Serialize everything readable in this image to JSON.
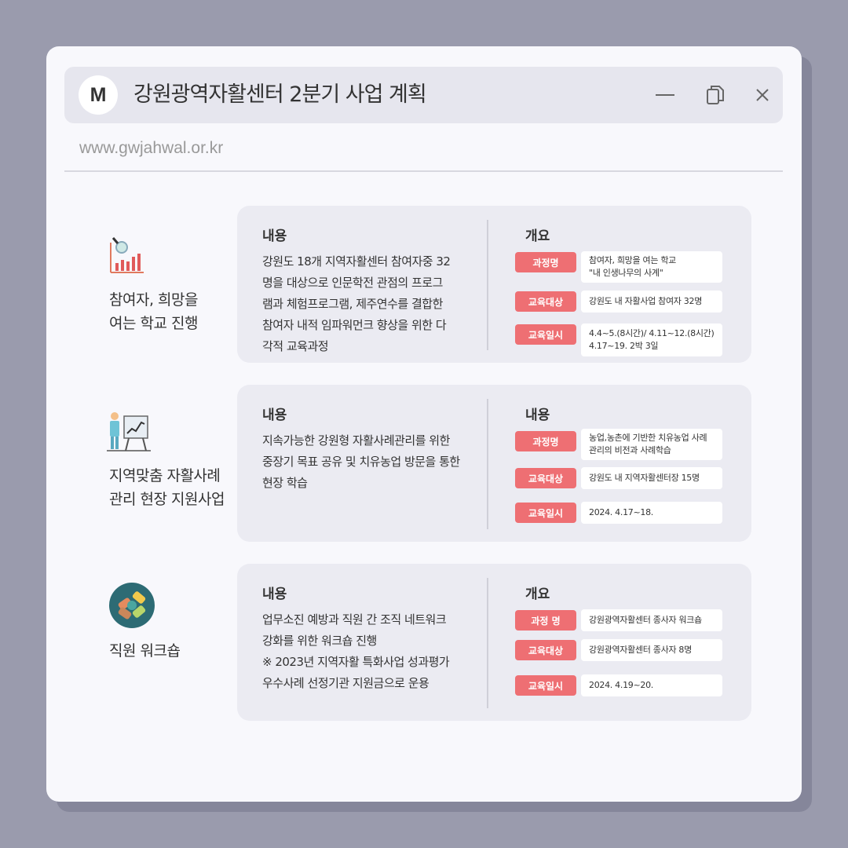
{
  "window": {
    "logo_letter": "M",
    "title": "강원광역자활센터 2분기 사업 계획",
    "url": "www.gwjahwal.or.kr"
  },
  "items": [
    {
      "label_line1": "참여자, 희망을",
      "label_line2": "여는 학교 진행",
      "icon": "chart-magnifier-icon",
      "heading_left": "내용",
      "heading_right": "개요",
      "body_line1": "강원도 18개 지역자활센터 참여자중 32",
      "body_line2": "명을 대상으로 인문학전 관점의 프로그",
      "body_line3": "램과 체험프로그램, 제주연수를 결합한",
      "body_line4": "참여자 내적 임파워먼크 향상을 위한 다",
      "body_line5": "각적 교육과정",
      "tag1": "과정명",
      "val1_line1": "참여자, 희망을 여는 학교",
      "val1_line2": "\"내 인생나무의 사계\"",
      "tag2": "교육대상",
      "val2_line1": "강원도 내 자활사업 참여자 32명",
      "tag3": "교육일시",
      "val3_line1": "4.4~5.(8시간)/  4.11~12.(8시간)",
      "val3_line2": "4.17~19. 2박 3일"
    },
    {
      "label_line1": "지역맞춤 자활사례",
      "label_line2": "관리 현장 지원사업",
      "icon": "presentation-icon",
      "heading_left": "내용",
      "heading_right": "내용",
      "body_line1": "지속가능한 강원형 자활사례관리를 위한",
      "body_line2": "중장기 목표 공유 및 치유농업 방문을 통한",
      "body_line3": "현장 학습",
      "tag1": "과정명",
      "val1_line1": "농업,농촌에 기반한 치유농업 사례",
      "val1_line2": "관리의 비전과 사례학습",
      "tag2": "교육대상",
      "val2_line1": "강원도 내 지역자활센터장 15명",
      "tag3": "교육일시",
      "val3_line1": "2024. 4.17~18."
    },
    {
      "label_line1": "직원 워크숍",
      "icon": "teamwork-hands-icon",
      "heading_left": "내용",
      "heading_right": "개요",
      "body_line1": "업무소진 예방과 직원 간 조직 네트워크",
      "body_line2": "강화를 위한 워크숍 진행",
      "body_line3": "※ 2023년 지역자활 특화사업 성과평가",
      "body_line4": "우수사례 선정기관 지원금으로 운용",
      "tag1": "과정 명",
      "val1_line1": "강원광역자활센터 종사자 워크숍",
      "tag2": "교육대상",
      "val2_line1": "강원광역자활센터 종사자 8명",
      "tag3": "교육일시",
      "val3_line1": "2024. 4.19~20."
    }
  ]
}
